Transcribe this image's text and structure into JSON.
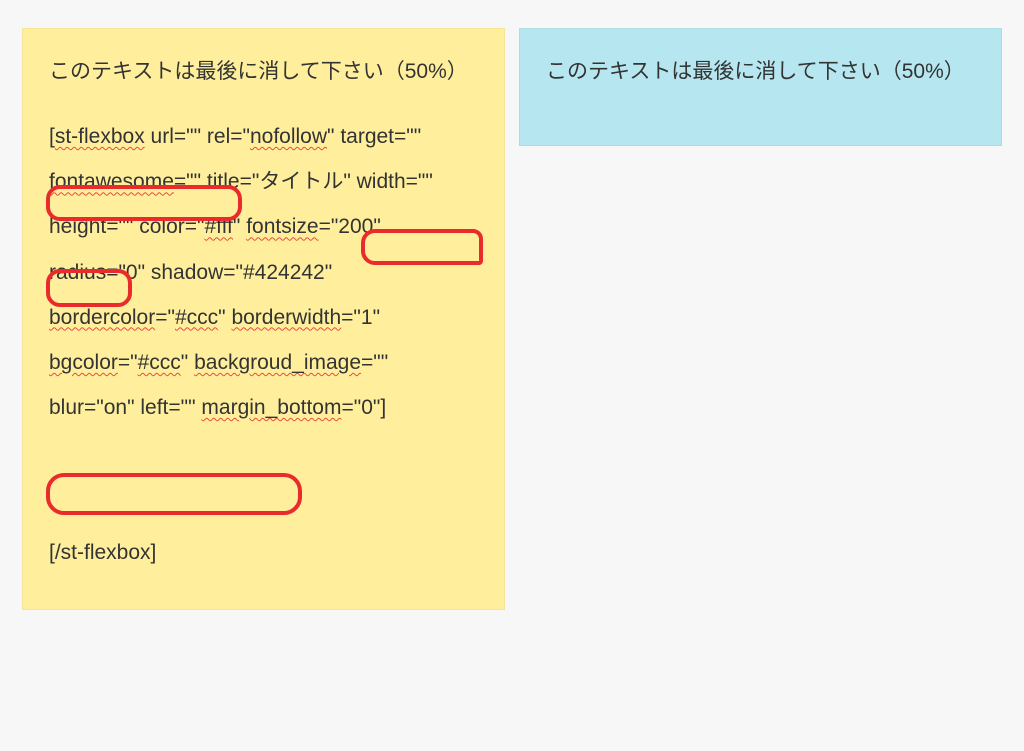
{
  "left": {
    "header": "このテキストは最後に消して下さい（50%）",
    "code_parts": {
      "p1a": "st-flexbox",
      "p1b": " url=\"\" ",
      "p1c": "rel=\"",
      "p1d": "nofollow",
      "p1e": "\" target=\"\" ",
      "p1f": "fontawesome",
      "p1g": "=\"\" ",
      "p1h": "title=\"タイトル\" ",
      "p1i": "width=\"\" height=\"\" color=\"",
      "p1j": "#fff",
      "p1k": "\" ",
      "p1l": "fontsize",
      "p1m": "=\"200\" radius=\"0\" shadow=\"#424242\" ",
      "p1n": "bordercolor",
      "p1o": "=\"",
      "p1p": "#ccc",
      "p1q": "\" ",
      "p1r": "borderwidth",
      "p1s": "=\"1\" ",
      "p1t": "bgcolor",
      "p1u": "=\"",
      "p1v": "#ccc",
      "p1w": "\" ",
      "p1x": "backgroud_image",
      "p1y": "=\"\" ",
      "p1z": "blur=\"on\" left=\"\" ",
      "p2a": "margin_bottom",
      "p2b": "=\"0\"]"
    },
    "closing": "[/st-flexbox]"
  },
  "right": {
    "header": "このテキストは最後に消して下さい（50%）"
  }
}
